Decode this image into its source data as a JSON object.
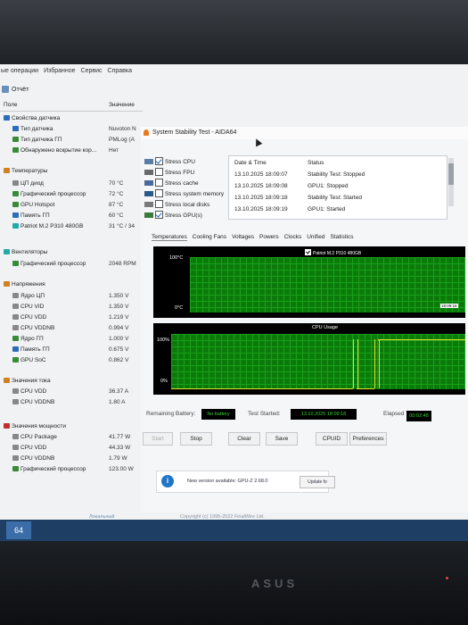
{
  "main_window": {
    "menu": [
      "ые операции",
      "Избранное",
      "Сервис",
      "Справка"
    ],
    "toolbar_report": "Отчёт",
    "columns": {
      "field": "Поле",
      "value": "Значение"
    },
    "rows": [
      {
        "name": "Свойства датчика",
        "value": "",
        "icon": "sensor-props-icon"
      },
      {
        "name": "Тип датчика",
        "value": "Nuvoton N",
        "icon": "sensor-icon"
      },
      {
        "name": "Тип датчика ГП",
        "value": "PMLog (A",
        "icon": "gpu-icon"
      },
      {
        "name": "Обнаружено вскрытие кор...",
        "value": "Нет",
        "icon": "check-icon"
      },
      {
        "name": "Температуры",
        "value": "",
        "icon": "thermometer-icon"
      },
      {
        "name": "ЦП диод",
        "value": "70 °C",
        "icon": "cpu-icon"
      },
      {
        "name": "Графический процессор",
        "value": "72 °C",
        "icon": "gpu-icon"
      },
      {
        "name": "GPU Hotspot",
        "value": "87 °C",
        "icon": "gpu-icon"
      },
      {
        "name": "Память ГП",
        "value": "60 °C",
        "icon": "memory-icon"
      },
      {
        "name": "Patriot M.2 P310 480GB",
        "value": "31 °C / 34",
        "icon": "disk-icon"
      },
      {
        "name": "Вентиляторы",
        "value": "",
        "icon": "fan-icon"
      },
      {
        "name": "Графический процессор",
        "value": "2048 RPM",
        "icon": "gpu-icon"
      },
      {
        "name": "Напряжения",
        "value": "",
        "icon": "voltage-icon"
      },
      {
        "name": "Ядро ЦП",
        "value": "1.350 V",
        "icon": "cpu-icon"
      },
      {
        "name": "CPU VID",
        "value": "1.350 V",
        "icon": "cpu-icon"
      },
      {
        "name": "CPU VDD",
        "value": "1.219 V",
        "icon": "cpu-icon"
      },
      {
        "name": "CPU VDDNB",
        "value": "0.994 V",
        "icon": "cpu-icon"
      },
      {
        "name": "Ядро ГП",
        "value": "1.000 V",
        "icon": "gpu-icon"
      },
      {
        "name": "Память ГП",
        "value": "0.675 V",
        "icon": "memory-icon"
      },
      {
        "name": "GPU SoC",
        "value": "0.862 V",
        "icon": "gpu-icon"
      },
      {
        "name": "Значения тока",
        "value": "",
        "icon": "current-icon"
      },
      {
        "name": "CPU VDD",
        "value": "36.37 A",
        "icon": "cpu-icon"
      },
      {
        "name": "CPU VDDNB",
        "value": "1.80 A",
        "icon": "cpu-icon"
      },
      {
        "name": "Значения мощности",
        "value": "",
        "icon": "power-icon"
      },
      {
        "name": "CPU Package",
        "value": "41.77 W",
        "icon": "cpu-icon"
      },
      {
        "name": "CPU VDD",
        "value": "44.33 W",
        "icon": "cpu-icon"
      },
      {
        "name": "CPU VDDNB",
        "value": "1.79 W",
        "icon": "cpu-icon"
      },
      {
        "name": "Графический процессор",
        "value": "123.00 W",
        "icon": "gpu-icon"
      }
    ],
    "status_left": "Локальный",
    "copyright": "Copyright (c) 1995-2022 FinalWire Ltd."
  },
  "stability": {
    "title": "System Stability Test - AIDA64",
    "checks": [
      {
        "label": "Stress CPU",
        "checked": true
      },
      {
        "label": "Stress FPU",
        "checked": false
      },
      {
        "label": "Stress cache",
        "checked": false
      },
      {
        "label": "Stress system memory",
        "checked": false
      },
      {
        "label": "Stress local disks",
        "checked": false
      },
      {
        "label": "Stress GPU(s)",
        "checked": true
      }
    ],
    "log_headers": {
      "date": "Date & Time",
      "status": "Status"
    },
    "log": [
      {
        "date": "13.10.2025 18:09:07",
        "status": "Stability Test: Stopped"
      },
      {
        "date": "13.10.2025 18:09:08",
        "status": "GPU1: Stopped"
      },
      {
        "date": "13.10.2025 18:09:18",
        "status": "Stability Test: Started"
      },
      {
        "date": "13.10.2025 18:09:19",
        "status": "GPU1: Started"
      }
    ],
    "tabs": [
      "Temperatures",
      "Cooling Fans",
      "Voltages",
      "Powers",
      "Clocks",
      "Unified",
      "Statistics"
    ],
    "temp_graph": {
      "top": "100°C",
      "bottom": "0°C",
      "legend": "Patriot M.2 P310 480GB",
      "time_right": "18:09:18"
    },
    "cpu_graph": {
      "title": "CPU Usage",
      "top": "100%",
      "bottom": "0%"
    },
    "battery_label": "Remaining Battery:",
    "battery_value": "No battery",
    "started_label": "Test Started:",
    "started_value": "13.10.2025 18:09:18",
    "elapsed_label": "Elapsed Time:",
    "elapsed_value": "00:02:48",
    "buttons": [
      "Start",
      "Stop",
      "Clear",
      "Save",
      "CPUID",
      "Preferences"
    ],
    "notification": "New version available: GPU-Z 2.68.0",
    "update_button": "Update fo",
    "info_glyph": "i"
  },
  "taskbar": {
    "app_label": "64"
  },
  "brand": "ASUS"
}
